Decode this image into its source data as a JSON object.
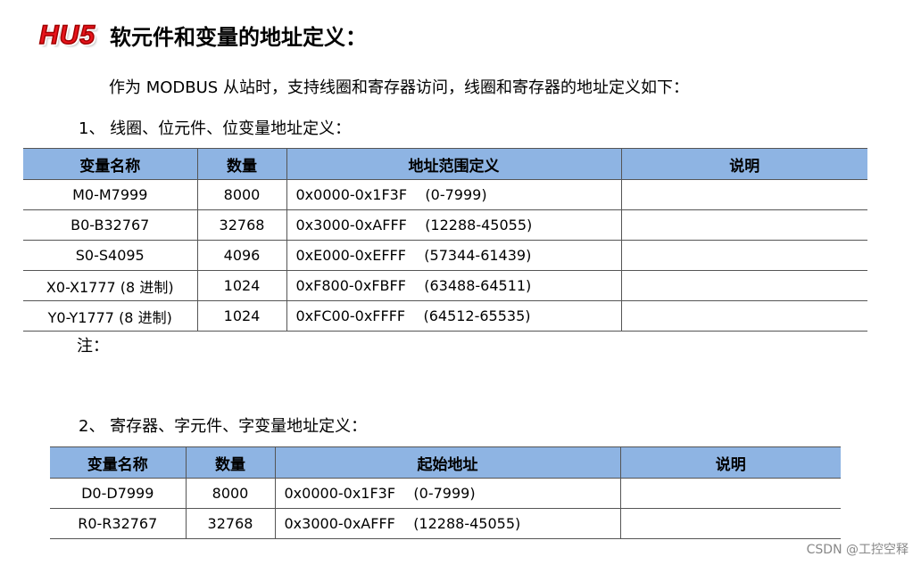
{
  "logo_text": "HU5",
  "title": "软元件和变量的地址定义：",
  "intro": "作为 MODBUS 从站时，支持线圈和寄存器访问，线圈和寄存器的地址定义如下：",
  "section1": {
    "heading": "1、 线圈、位元件、位变量地址定义：",
    "headers": [
      "变量名称",
      "数量",
      "地址范围定义",
      "说明"
    ],
    "rows": [
      [
        "M0-M7999",
        "8000",
        "0x0000-0x1F3F    (0-7999)",
        ""
      ],
      [
        "B0-B32767",
        "32768",
        "0x3000-0xAFFF    (12288-45055)",
        ""
      ],
      [
        "S0-S4095",
        "4096",
        "0xE000-0xEFFF    (57344-61439)",
        ""
      ],
      [
        "X0-X1777 (8 进制)",
        "1024",
        "0xF800-0xFBFF    (63488-64511)",
        ""
      ],
      [
        "Y0-Y1777 (8 进制)",
        "1024",
        "0xFC00-0xFFFF    (64512-65535)",
        ""
      ]
    ]
  },
  "note": "注：",
  "section2": {
    "heading": "2、 寄存器、字元件、字变量地址定义：",
    "headers": [
      "变量名称",
      "数量",
      "起始地址",
      "说明"
    ],
    "rows": [
      [
        "D0-D7999",
        "8000",
        "0x0000-0x1F3F    (0-7999)",
        ""
      ],
      [
        "R0-R32767",
        "32768",
        "0x3000-0xAFFF    (12288-45055)",
        ""
      ]
    ]
  },
  "watermark": "CSDN @工控空释"
}
